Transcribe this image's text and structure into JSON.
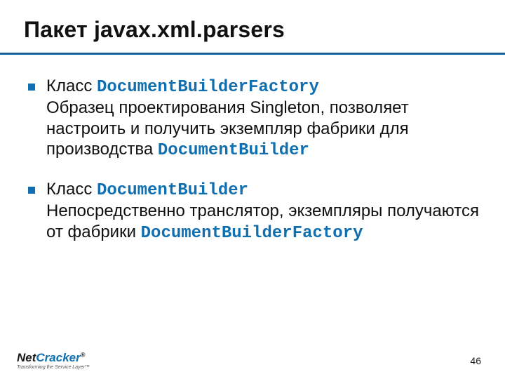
{
  "title": "Пакет javax.xml.parsers",
  "items": [
    {
      "label": "Класс ",
      "class_name": "DocumentBuilderFactory",
      "desc_pre": "Образец проектирования Singleton, позволяет настроить и получить экземпляр фабрики для производства ",
      "desc_code": "DocumentBuilder",
      "desc_post": ""
    },
    {
      "label": "Класс ",
      "class_name": "DocumentBuilder",
      "desc_pre": "Непосредственно транслятор, экземпляры получаются от фабрики ",
      "desc_code": "DocumentBuilderFactory",
      "desc_post": ""
    }
  ],
  "footer": {
    "logo_net": "Net",
    "logo_cracker": "Cracker",
    "logo_reg": "®",
    "tagline": "Transforming the Service Layer™",
    "page": "46"
  }
}
